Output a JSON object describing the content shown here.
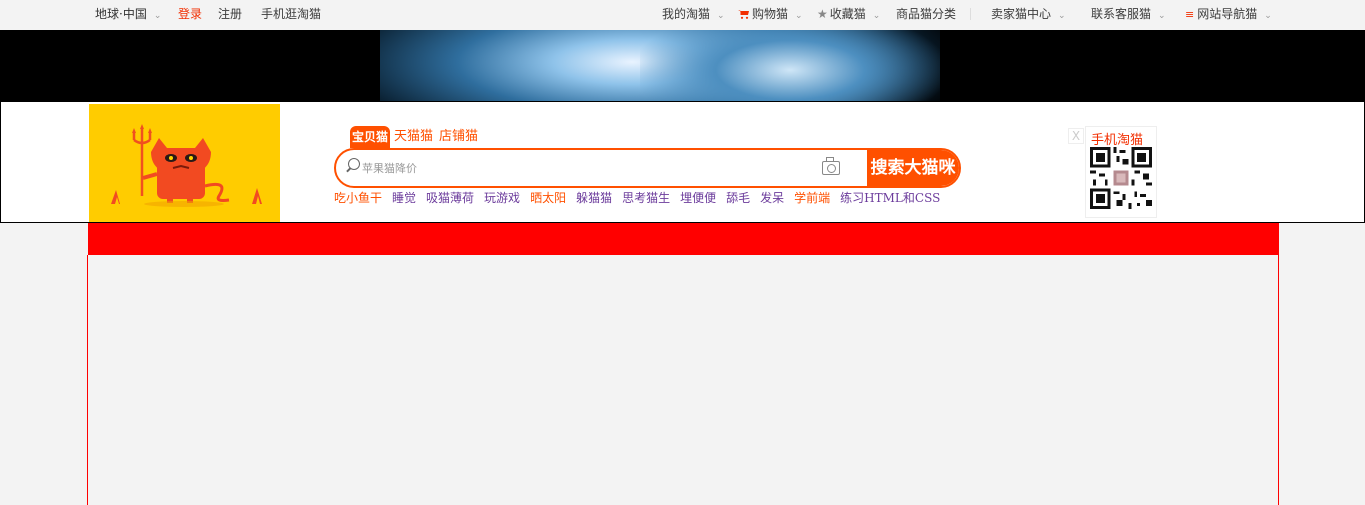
{
  "topnav": {
    "region": "地球·中国",
    "login": "登录",
    "register": "注册",
    "mobile": "手机逛淘猫",
    "my_taomao": "我的淘猫",
    "cart": "购物猫",
    "favorites": "收藏猫",
    "categories": "商品猫分类",
    "seller": "卖家猫中心",
    "service": "联系客服猫",
    "sitenav": "网站导航猫",
    "colors": {
      "accent": "#f22e00"
    }
  },
  "search": {
    "tabs": [
      {
        "label": "宝贝猫",
        "active": true
      },
      {
        "label": "天猫猫",
        "active": false
      },
      {
        "label": "店铺猫",
        "active": false
      }
    ],
    "placeholder": "苹果猫降价",
    "button_label": "搜索大猫咪",
    "accent_color": "#ff5000"
  },
  "hotwords": [
    {
      "label": "吃小鱼干",
      "highlight": true
    },
    {
      "label": "睡觉",
      "highlight": false
    },
    {
      "label": "吸猫薄荷",
      "highlight": false
    },
    {
      "label": "玩游戏",
      "highlight": false
    },
    {
      "label": "晒太阳",
      "highlight": true
    },
    {
      "label": "躲猫猫",
      "highlight": false
    },
    {
      "label": "思考猫生",
      "highlight": false
    },
    {
      "label": "埋便便",
      "highlight": false
    },
    {
      "label": "舔毛",
      "highlight": false
    },
    {
      "label": "发呆",
      "highlight": false
    },
    {
      "label": "学前端",
      "highlight": true
    },
    {
      "label": "练习HTML和CSS",
      "highlight": false
    }
  ],
  "mobile_qr": {
    "title": "手机淘猫",
    "close": "X"
  }
}
